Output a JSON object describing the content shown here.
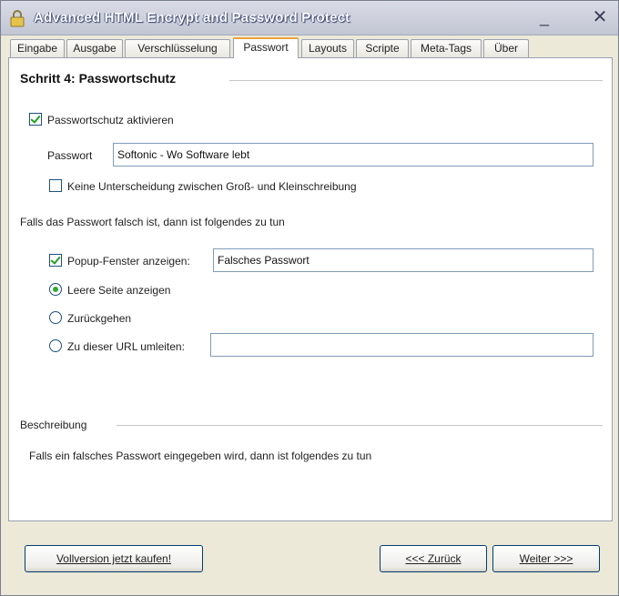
{
  "window": {
    "title": "Advanced HTML Encrypt and Password Protect",
    "minimize_glyph": "_",
    "close_glyph": "✕"
  },
  "tabs": [
    {
      "label": "Eingabe"
    },
    {
      "label": "Ausgabe"
    },
    {
      "label": "Verschlüsselung"
    },
    {
      "label": "Passwort",
      "active": true
    },
    {
      "label": "Layouts"
    },
    {
      "label": "Scripte"
    },
    {
      "label": "Meta-Tags"
    },
    {
      "label": "Über"
    }
  ],
  "step": {
    "title": "Schritt 4: Passwortschutz"
  },
  "protection": {
    "enable_label": "Passwortschutz aktivieren",
    "enable_checked": true,
    "password_label": "Passwort",
    "password_value": "Softonic - Wo Software lebt",
    "case_label": "Keine Unterscheidung zwischen Groß- und Kleinschreibung",
    "case_checked": false
  },
  "wrong_password": {
    "intro": "Falls das Passwort falsch ist, dann ist folgendes zu tun",
    "popup_label": "Popup-Fenster anzeigen:",
    "popup_checked": true,
    "popup_value": "Falsches Passwort",
    "options": [
      {
        "label": "Leere Seite anzeigen",
        "selected": true
      },
      {
        "label": "Zurückgehen",
        "selected": false
      },
      {
        "label": "Zu dieser URL umleiten:",
        "selected": false
      }
    ],
    "url_value": ""
  },
  "description": {
    "heading": "Beschreibung",
    "text": "Falls ein falsches Passwort eingegeben wird, dann ist folgendes zu tun"
  },
  "footer": {
    "buy_label": "Vollversion jetzt kaufen!",
    "back_label": "<<< Zurück",
    "next_label": "Weiter >>>"
  },
  "colors": {
    "title_bar": "#c6cad6",
    "active_tab_accent": "#e9a23c",
    "check_green": "#21a121"
  },
  "icons": {
    "app": "lock-icon",
    "minimize": "minimize-icon",
    "close": "close-icon"
  }
}
